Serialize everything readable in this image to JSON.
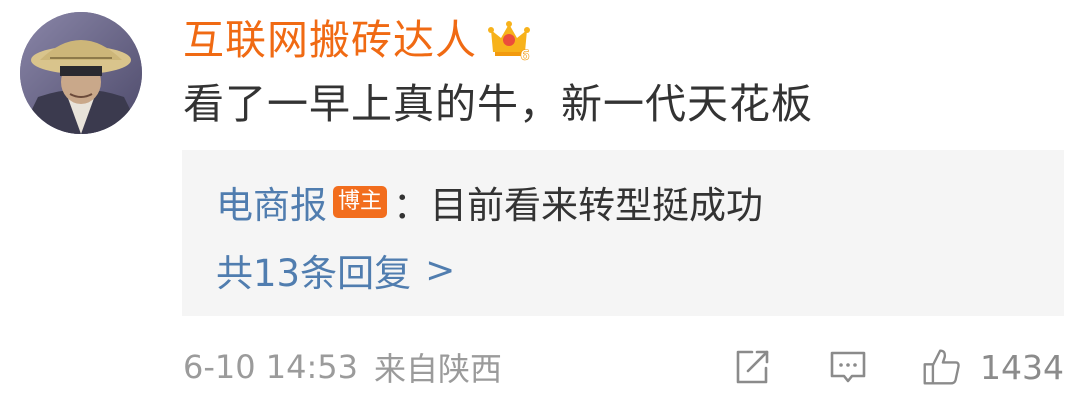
{
  "comment": {
    "username": "互联网搬砖达人",
    "vip_level": "6",
    "text": "看了一早上真的牛，新一代天花板",
    "reply": {
      "author": "电商报",
      "badge": "博主",
      "text": "：目前看来转型挺成功",
      "count_label": "共13条回复",
      "arrow": ">"
    },
    "meta": {
      "time": "6-10 14:53",
      "source": "来自陕西"
    },
    "like_count": "1434"
  },
  "colors": {
    "username": "#f06a13",
    "link": "#507daf",
    "badge": "#f26d1d",
    "reply_bg": "#f5f5f5",
    "meta": "#9b9b9b"
  },
  "icons": [
    "avatar-image",
    "crown-icon",
    "share-icon",
    "comment-icon",
    "thumbs-up-icon"
  ]
}
